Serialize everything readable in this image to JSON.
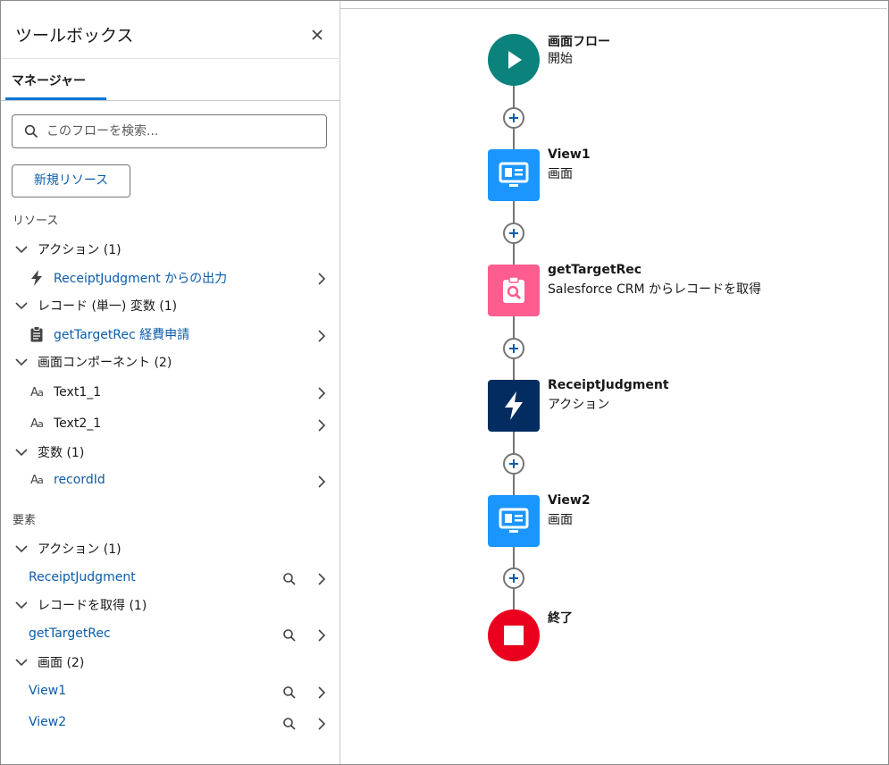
{
  "toolbox": {
    "title": "ツールボックス",
    "tab": "マネージャー",
    "search_placeholder": "このフローを検索...",
    "new_resource": "新規リソース",
    "resources_label": "リソース",
    "elements_label": "要素",
    "resources": {
      "actions_group": "アクション (1)",
      "action_item": "ReceiptJudgment からの出力",
      "record_group": "レコード (単一) 変数 (1)",
      "record_item": "getTargetRec 経費申請",
      "screen_comp_group": "画面コンポーネント (2)",
      "text1": "Text1_1",
      "text2": "Text2_1",
      "vars_group": "変数 (1)",
      "var_item": "recordId"
    },
    "elements": {
      "actions_group": "アクション (1)",
      "action_item": "ReceiptJudgment",
      "getrec_group": "レコードを取得 (1)",
      "getrec_item": "getTargetRec",
      "screens_group": "画面 (2)",
      "screen1": "View1",
      "screen2": "View2"
    }
  },
  "flow": {
    "start": {
      "title": "画面フロー",
      "subtitle": "開始"
    },
    "view1": {
      "title": "View1",
      "subtitle": "画面"
    },
    "get": {
      "title": "getTargetRec",
      "subtitle": "Salesforce CRM からレコードを取得"
    },
    "action": {
      "title": "ReceiptJudgment",
      "subtitle": "アクション"
    },
    "view2": {
      "title": "View2",
      "subtitle": "画面"
    },
    "end": {
      "title": "終了"
    }
  },
  "colors": {
    "start": "#0b827c",
    "screen": "#1b96ff",
    "get_records": "#ff5d8f",
    "action": "#032d60",
    "end": "#ea001e",
    "link": "#0b5cab"
  },
  "icons": [
    "close-icon",
    "search-icon",
    "chevron-down-icon",
    "chevron-right-icon",
    "lightning-icon",
    "clipboard-icon",
    "text-icon",
    "play-icon",
    "screen-icon",
    "record-search-icon",
    "stop-icon",
    "plus-icon"
  ]
}
